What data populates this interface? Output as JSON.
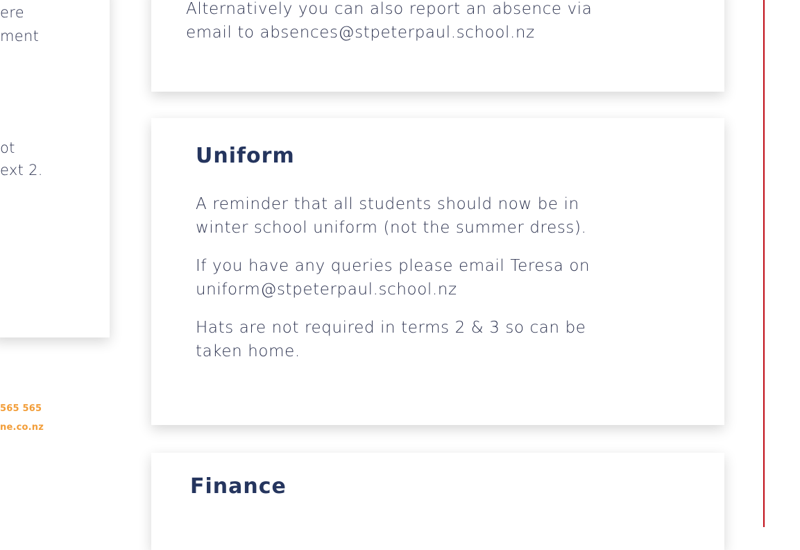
{
  "left_panel": {
    "fragments": [
      "ere",
      "ment",
      "ot",
      "ext 2."
    ],
    "footer": [
      "565 565",
      "ne.co.nz"
    ],
    "footer_color": "#f29d38"
  },
  "absence": {
    "lines": [
      "Alternatively you can also report an absence via",
      "email to absences@stpeterpaul.school.nz"
    ]
  },
  "uniform": {
    "heading": "Uniform",
    "paragraphs": [
      [
        "A reminder that all students should now be in",
        "winter school uniform (not the summer dress)."
      ],
      [
        "If you have any queries please email Teresa on",
        "uniform@stpeterpaul.school.nz"
      ],
      [
        "Hats are not required in terms 2 & 3 so can be",
        "taken home."
      ]
    ]
  },
  "finance": {
    "heading": "Finance"
  },
  "colors": {
    "heading": "#25355e",
    "body_text": "#2e3451",
    "accent_rule": "#c00b16"
  }
}
